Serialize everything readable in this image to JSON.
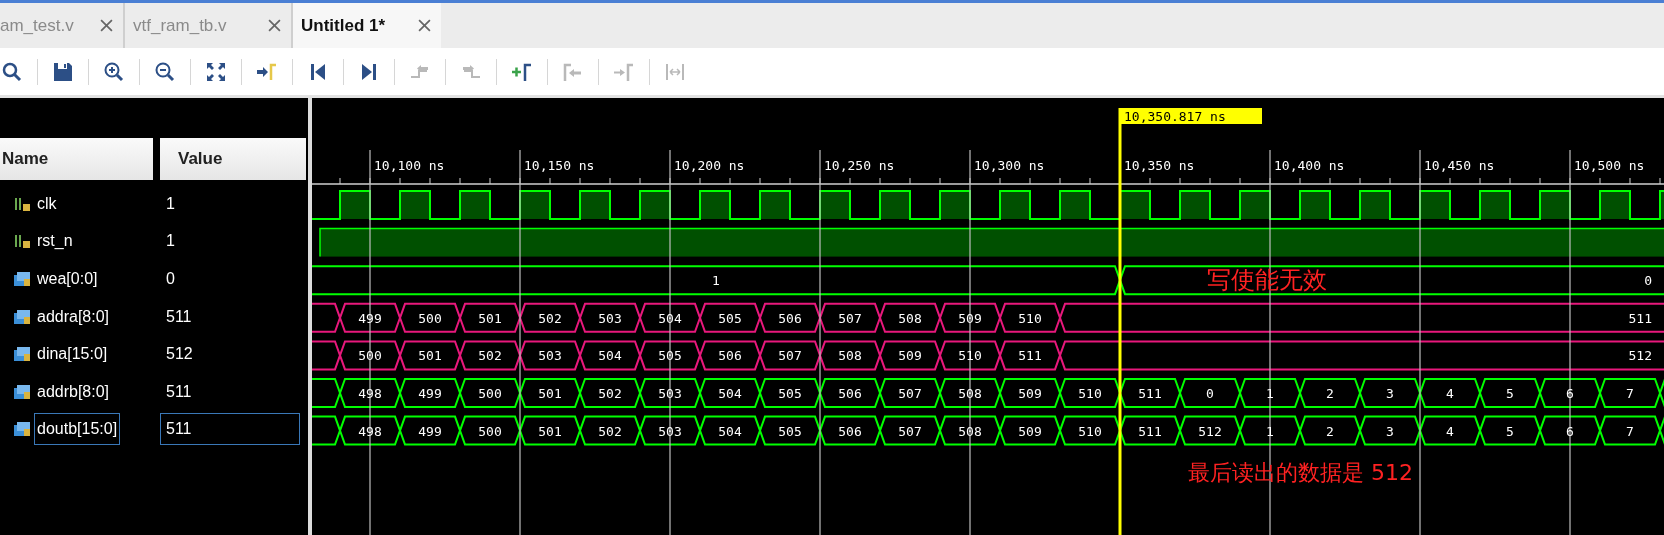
{
  "tabs": [
    {
      "label": "am_test.v",
      "selected": false
    },
    {
      "label": "vtf_ram_tb.v",
      "selected": false
    },
    {
      "label": "Untitled 1*",
      "selected": true
    }
  ],
  "toolbar": [
    {
      "disabled": false
    },
    {
      "disabled": false
    },
    {
      "disabled": false
    },
    {
      "disabled": false
    },
    {
      "disabled": false
    },
    {
      "disabled": false
    },
    {
      "disabled": false
    },
    {
      "disabled": false
    },
    {
      "disabled": true
    },
    {
      "disabled": true
    },
    {
      "disabled": false
    },
    {
      "disabled": true
    },
    {
      "disabled": true
    },
    {
      "disabled": true
    }
  ],
  "headers": {
    "name": "Name",
    "value": "Value"
  },
  "time_axis": {
    "ticks": [
      "10,100 ns",
      "10,150 ns",
      "10,200 ns",
      "10,250 ns",
      "10,300 ns",
      "10,350 ns",
      "10,400 ns",
      "10,450 ns",
      "10,500 ns"
    ]
  },
  "cursor": {
    "time": "10,350.817 ns"
  },
  "signals": [
    {
      "name": "clk",
      "value": "1",
      "kind": "clock",
      "color": "#00ff00",
      "selected": false
    },
    {
      "name": "rst_n",
      "value": "1",
      "kind": "bit",
      "color": "#00ff00",
      "selected": false
    },
    {
      "name": "wea[0:0]",
      "value": "0",
      "kind": "level",
      "color": "#00ff00",
      "selected": false,
      "segments": [
        "1",
        "0"
      ]
    },
    {
      "name": "addra[8:0]",
      "value": "511",
      "kind": "clocked",
      "color": "#e8187c",
      "selected": false,
      "holds": true,
      "segments": [
        "499",
        "500",
        "501",
        "502",
        "503",
        "504",
        "505",
        "506",
        "507",
        "508",
        "509",
        "510",
        "511"
      ]
    },
    {
      "name": "dina[15:0]",
      "value": "512",
      "kind": "clocked",
      "color": "#e8187c",
      "selected": false,
      "holds": true,
      "segments": [
        "500",
        "501",
        "502",
        "503",
        "504",
        "505",
        "506",
        "507",
        "508",
        "509",
        "510",
        "511",
        "512"
      ]
    },
    {
      "name": "addrb[8:0]",
      "value": "511",
      "kind": "clocked",
      "color": "#00ff00",
      "selected": false,
      "holds": false,
      "segments": [
        "498",
        "499",
        "500",
        "501",
        "502",
        "503",
        "504",
        "505",
        "506",
        "507",
        "508",
        "509",
        "510",
        "511",
        "0",
        "1",
        "2",
        "3",
        "4",
        "5",
        "6",
        "7"
      ]
    },
    {
      "name": "doutb[15:0]",
      "value": "511",
      "kind": "clocked",
      "color": "#00ff00",
      "selected": true,
      "holds": false,
      "segments": [
        "498",
        "499",
        "500",
        "501",
        "502",
        "503",
        "504",
        "505",
        "506",
        "507",
        "508",
        "509",
        "510",
        "511",
        "512",
        "1",
        "2",
        "3",
        "4",
        "5",
        "6",
        "7"
      ]
    }
  ],
  "annotations": [
    {
      "text": "写使能无效"
    },
    {
      "text": "最后读出的数据是 512"
    }
  ]
}
